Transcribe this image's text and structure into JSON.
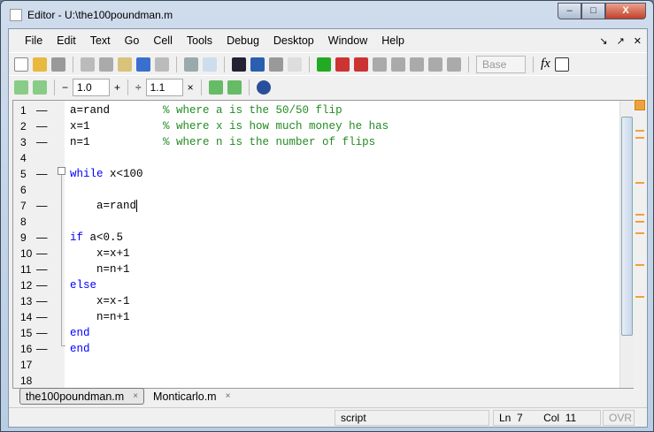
{
  "window": {
    "title": "Editor - U:\\the100poundman.m",
    "minimize": "–",
    "maximize": "□",
    "close": "X"
  },
  "menu": [
    "File",
    "Edit",
    "Text",
    "Go",
    "Cell",
    "Tools",
    "Debug",
    "Desktop",
    "Window",
    "Help"
  ],
  "menu_right": {
    "undock": "↘",
    "dock": "↗",
    "close": "✕"
  },
  "toolbar": {
    "base_select": "Base",
    "fx": "fx"
  },
  "cell_toolbar": {
    "minus": "−",
    "value1": "1.0",
    "plus": "+",
    "divide": "÷",
    "value2": "1.1",
    "times": "×"
  },
  "code_lines": [
    {
      "n": "1",
      "dash": "—",
      "parts": [
        [
          "",
          "a=rand        "
        ],
        [
          "cm",
          "% where a is the 50/50 flip"
        ]
      ]
    },
    {
      "n": "2",
      "dash": "—",
      "parts": [
        [
          "",
          "x=1           "
        ],
        [
          "cm",
          "% where x is how much money he has"
        ]
      ]
    },
    {
      "n": "3",
      "dash": "—",
      "parts": [
        [
          "",
          "n=1           "
        ],
        [
          "cm",
          "% where n is the number of flips"
        ]
      ]
    },
    {
      "n": "4",
      "dash": "",
      "parts": []
    },
    {
      "n": "5",
      "dash": "—",
      "parts": [
        [
          "kw",
          "while"
        ],
        [
          "",
          " x<100"
        ]
      ]
    },
    {
      "n": "6",
      "dash": "",
      "parts": []
    },
    {
      "n": "7",
      "dash": "—",
      "parts": [
        [
          "",
          "    a=rand"
        ]
      ]
    },
    {
      "n": "8",
      "dash": "",
      "parts": []
    },
    {
      "n": "9",
      "dash": "—",
      "parts": [
        [
          "kw",
          "if"
        ],
        [
          "",
          " a<0.5"
        ]
      ]
    },
    {
      "n": "10",
      "dash": "—",
      "parts": [
        [
          "",
          "    x=x+1"
        ]
      ]
    },
    {
      "n": "11",
      "dash": "—",
      "parts": [
        [
          "",
          "    n=n+1"
        ]
      ]
    },
    {
      "n": "12",
      "dash": "—",
      "parts": [
        [
          "kw",
          "else"
        ]
      ]
    },
    {
      "n": "13",
      "dash": "—",
      "parts": [
        [
          "",
          "    x=x-1"
        ]
      ]
    },
    {
      "n": "14",
      "dash": "—",
      "parts": [
        [
          "",
          "    n=n+1"
        ]
      ]
    },
    {
      "n": "15",
      "dash": "—",
      "parts": [
        [
          "kw",
          "end"
        ]
      ]
    },
    {
      "n": "16",
      "dash": "—",
      "parts": [
        [
          "kw",
          "end"
        ]
      ]
    },
    {
      "n": "17",
      "dash": "",
      "parts": []
    },
    {
      "n": "18",
      "dash": "",
      "parts": []
    }
  ],
  "tabs": [
    {
      "label": "the100poundman.m",
      "close": "×"
    },
    {
      "label": "Monticarlo.m",
      "close": "×"
    }
  ],
  "status": {
    "mode": "script",
    "ln_label": "Ln",
    "ln": "7",
    "col_label": "Col",
    "col": "11",
    "ovr": "OVR"
  },
  "colors": {
    "keyword": "#0000ff",
    "comment": "#228b22"
  }
}
